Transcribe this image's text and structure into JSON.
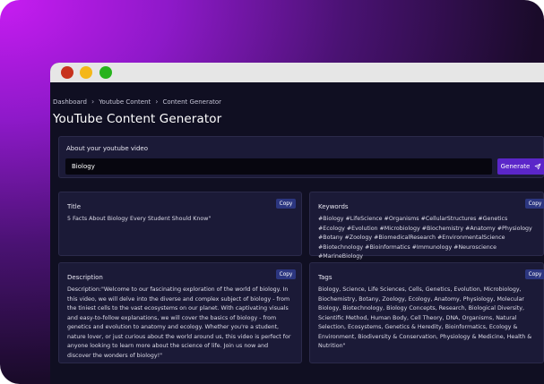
{
  "breadcrumb": [
    "Dashboard",
    "Youtube Content",
    "Content Generator"
  ],
  "page_title": "YouTube Content Generator",
  "about": {
    "label": "About your youtube video",
    "input_value": "Biology",
    "generate_label": "Generate"
  },
  "copy_label": "Copy",
  "title_card": {
    "heading": "Title",
    "body": "5 Facts About Biology Every Student Should Know\""
  },
  "keywords_card": {
    "heading": "Keywords",
    "body": "#Biology #LifeScience #Organisms #CellularStructures #Genetics #Ecology #Evolution #Microbiology #Biochemistry #Anatomy #Physiology #Botany #Zoology #BiomedicalResearch #EnvironmentalScience #Biotechnology #Bioinformatics #Immunology #Neuroscience #MarineBiology"
  },
  "description_card": {
    "heading": "Description",
    "body": "Description:\"Welcome to our fascinating exploration of the world of biology. In this video, we will delve into the diverse and complex subject of biology - from the tiniest cells to the vast ecosystems on our planet. With captivating visuals and easy-to-follow explanations, we will cover the basics of biology - from genetics and evolution to anatomy and ecology. Whether you're a student, nature lover, or just curious about the world around us, this video is perfect for anyone looking to learn more about the science of life. Join us now and discover the wonders of biology!\""
  },
  "tags_card": {
    "heading": "Tags",
    "body": "Biology, Science, Life Sciences, Cells, Genetics, Evolution, Microbiology, Biochemistry, Botany, Zoology, Ecology, Anatomy, Physiology, Molecular Biology, Biotechnology, Biology Concepts, Research, Biological Diversity, Scientific Method, Human Body, Cell Theory, DNA, Organisms, Natural Selection, Ecosystems, Genetics & Heredity, Bioinformatics, Ecology & Environment, Biodiversity & Conservation, Physiology & Medicine, Health & Nutrition\""
  },
  "icons": {
    "send": "send-icon",
    "chevron": "chevron-right-icon"
  },
  "colors": {
    "accent": "#5b26c9",
    "copy_button": "#2c3680",
    "card": "#1b1a37",
    "window": "#100f22"
  }
}
